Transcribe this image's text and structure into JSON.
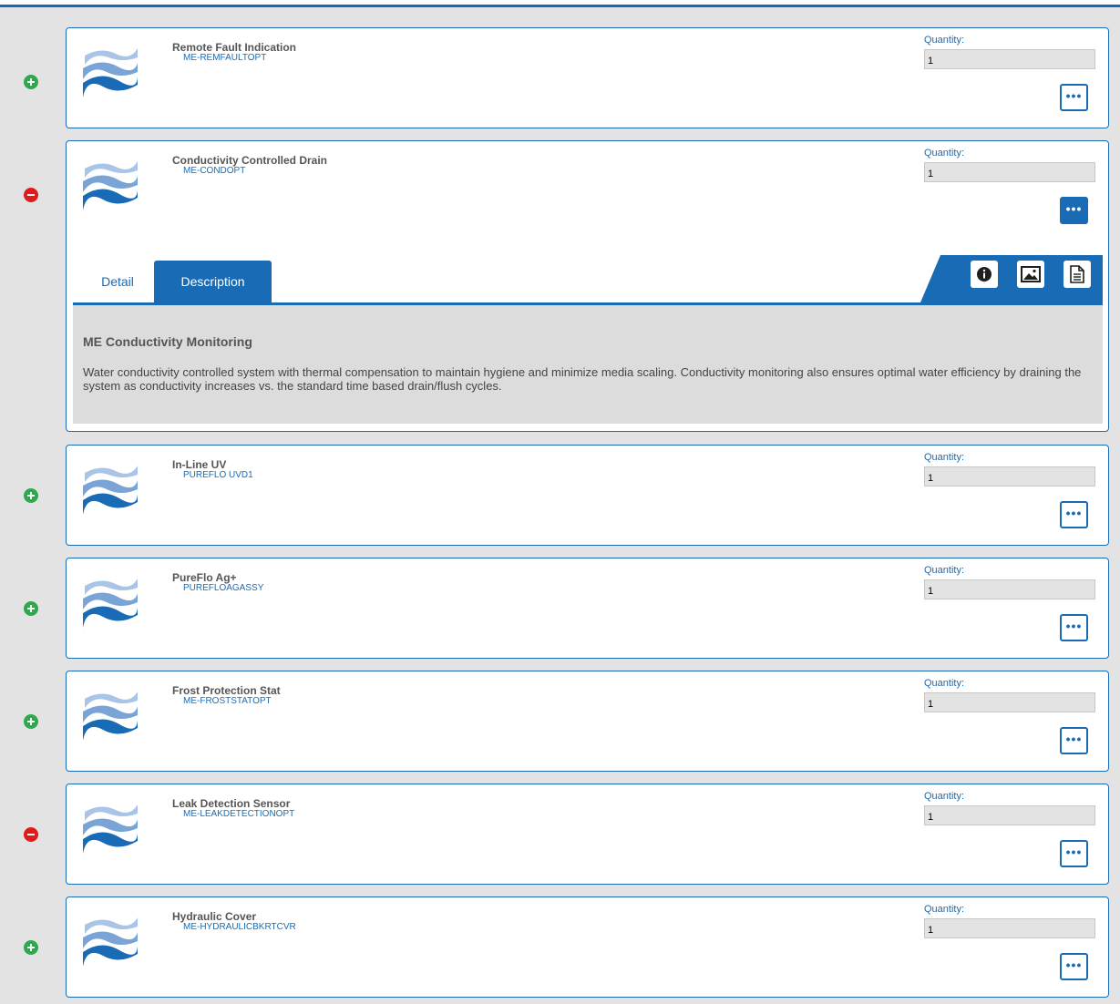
{
  "quantity_label": "Quantity:",
  "more_label": "•••",
  "colors": {
    "accent": "#1a6bb5",
    "add": "#2ea84a",
    "remove": "#e01b1b"
  },
  "items": [
    {
      "name": "Remote Fault Indication",
      "code": "ME-REMFAULTOPT",
      "quantity": "1",
      "toggle": "add",
      "toggle_icon": "plus-circle-icon"
    },
    {
      "name": "Conductivity Controlled Drain",
      "code": "ME-CONDOPT",
      "quantity": "1",
      "toggle": "remove",
      "toggle_icon": "minus-circle-icon",
      "expanded": true
    },
    {
      "name": "In-Line UV",
      "code": "PUREFLO UVD1",
      "quantity": "1",
      "toggle": "add",
      "toggle_icon": "plus-circle-icon"
    },
    {
      "name": "PureFlo Ag+",
      "code": "PUREFLOAGASSY",
      "quantity": "1",
      "toggle": "add",
      "toggle_icon": "plus-circle-icon"
    },
    {
      "name": "Frost Protection Stat",
      "code": "ME-FROSTSTATOPT",
      "quantity": "1",
      "toggle": "add",
      "toggle_icon": "plus-circle-icon"
    },
    {
      "name": "Leak Detection Sensor",
      "code": "ME-LEAKDETECTIONOPT",
      "quantity": "1",
      "toggle": "remove",
      "toggle_icon": "minus-circle-icon"
    },
    {
      "name": "Hydraulic Cover",
      "code": "ME-HYDRAULICBKRTCVR",
      "quantity": "1",
      "toggle": "add",
      "toggle_icon": "plus-circle-icon"
    }
  ],
  "expanded_panel": {
    "tabs": [
      {
        "label": "Detail"
      },
      {
        "label": "Description",
        "active": true
      }
    ],
    "tool_icons": [
      "info-icon",
      "image-icon",
      "document-icon"
    ],
    "description_title": "ME Conductivity Monitoring",
    "description_text": "Water conductivity controlled system with thermal compensation to maintain hygiene and minimize media scaling. Conductivity monitoring also ensures optimal water efficiency by draining the system as conductivity increases vs. the standard time based drain/flush cycles."
  }
}
